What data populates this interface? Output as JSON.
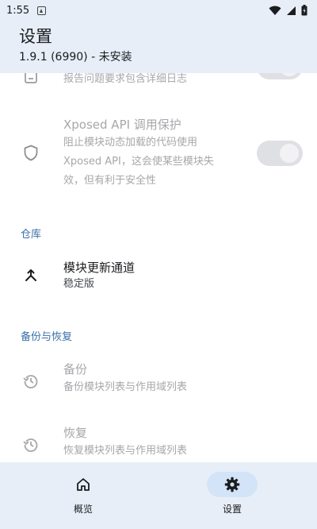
{
  "status_bar": {
    "time": "1:55"
  },
  "header": {
    "title": "设置",
    "subtitle": "1.9.1 (6990) - 未安装"
  },
  "settings": {
    "log_item": {
      "description": "报告问题要求包含详细日志"
    },
    "api_protection": {
      "title": "Xposed API 调用保护",
      "description_lines": [
        "阻止模块动态加载的代码使用",
        "Xposed API，这会使某些模块失",
        "效，但有利于安全性"
      ]
    }
  },
  "sections": {
    "repository": {
      "header": "仓库",
      "update_channel": {
        "title": "模块更新通道",
        "value": "稳定版"
      }
    },
    "backup_restore": {
      "header": "备份与恢复",
      "backup": {
        "title": "备份",
        "description": "备份模块列表与作用域列表"
      },
      "restore": {
        "title": "恢复",
        "description": "恢复模块列表与作用域列表"
      }
    }
  },
  "nav": {
    "items": [
      {
        "label": "概览",
        "icon": "home-icon"
      },
      {
        "label": "设置",
        "icon": "gear-icon",
        "active": true
      }
    ]
  },
  "colors": {
    "accent": "#3a6fa8",
    "surface_tint": "#e7eef7",
    "active_pill": "#d3e4f8"
  }
}
